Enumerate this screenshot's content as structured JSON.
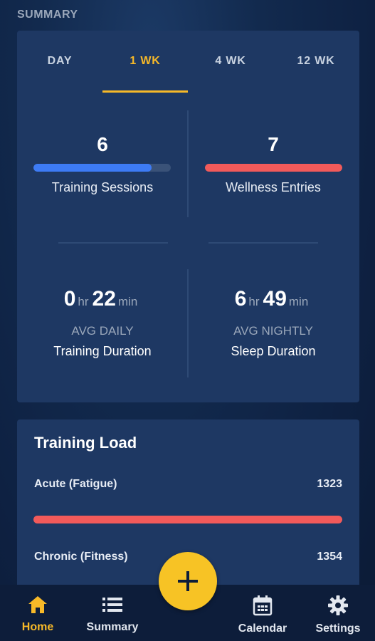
{
  "header": {
    "title": "SUMMARY"
  },
  "tabs": [
    {
      "label": "DAY"
    },
    {
      "label": "1 WK"
    },
    {
      "label": "4 WK"
    },
    {
      "label": "12 WK"
    }
  ],
  "active_tab": "1 WK",
  "stats": {
    "training_sessions": {
      "value": "6",
      "label": "Training Sessions",
      "progress": 0.86,
      "color": "#3d7bf5"
    },
    "wellness_entries": {
      "value": "7",
      "label": "Wellness Entries",
      "progress": 1.0,
      "color": "#f25a5a"
    }
  },
  "durations": {
    "training": {
      "hours": "0",
      "hr_unit": "hr",
      "minutes": "22",
      "min_unit": "min",
      "sub": "AVG DAILY",
      "label": "Training Duration"
    },
    "sleep": {
      "hours": "6",
      "hr_unit": "hr",
      "minutes": "49",
      "min_unit": "min",
      "sub": "AVG NIGHTLY",
      "label": "Sleep Duration"
    }
  },
  "training_load": {
    "title": "Training Load",
    "acute": {
      "label": "Acute (Fatigue)",
      "value": "1323"
    },
    "chronic": {
      "label": "Chronic (Fitness)",
      "value": "1354"
    }
  },
  "nav": {
    "home": "Home",
    "summary": "Summary",
    "calendar": "Calendar",
    "settings": "Settings"
  },
  "colors": {
    "accent": "#f7b928",
    "card": "#1e3863",
    "blue": "#3d7bf5",
    "red": "#f25a5a"
  }
}
